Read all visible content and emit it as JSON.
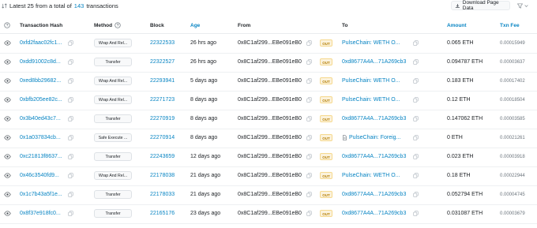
{
  "summary": {
    "prefix": "Latest 25 from a total of",
    "count": "143",
    "suffix": "transactions"
  },
  "toolbar": {
    "download_label": "Download Page Data"
  },
  "columns": {
    "hash": "Transaction Hash",
    "method": "Method",
    "block": "Block",
    "age": "Age",
    "from": "From",
    "to": "To",
    "amount": "Amount",
    "fee": "Txn Fee"
  },
  "rows": [
    {
      "hash": "0xfd2faac02fc1...",
      "method": "Wrap And Rel...",
      "block": "22322533",
      "age": "26 hrs ago",
      "from": "0x8C1af299...EBe091eB0",
      "direction": "OUT",
      "to": "PulseChain: WETH O...",
      "to_icon": "none",
      "amount": "0.065 ETH",
      "fee": "0.00015949"
    },
    {
      "hash": "0xdd91002c8d...",
      "method": "Transfer",
      "block": "22322527",
      "age": "26 hrs ago",
      "from": "0x8C1af299...EBe091eB0",
      "direction": "OUT",
      "to": "0xd8677A4A...71A269cb3",
      "to_icon": "none",
      "amount": "0.094787 ETH",
      "fee": "0.00003637"
    },
    {
      "hash": "0xed8bb29682...",
      "method": "Wrap And Rel...",
      "block": "22293941",
      "age": "5 days ago",
      "from": "0x8C1af299...EBe091eB0",
      "direction": "OUT",
      "to": "PulseChain: WETH O...",
      "to_icon": "none",
      "amount": "0.183 ETH",
      "fee": "0.00017402"
    },
    {
      "hash": "0xbfb205ee82c...",
      "method": "Wrap And Rel...",
      "block": "22271723",
      "age": "8 days ago",
      "from": "0x8C1af299...EBe091eB0",
      "direction": "OUT",
      "to": "PulseChain: WETH O...",
      "to_icon": "none",
      "amount": "0.12 ETH",
      "fee": "0.00018504"
    },
    {
      "hash": "0x3b40ed43c7...",
      "method": "Transfer",
      "block": "22270919",
      "age": "8 days ago",
      "from": "0x8C1af299...EBe091eB0",
      "direction": "OUT",
      "to": "0xd8677A4A...71A269cb3",
      "to_icon": "none",
      "amount": "0.147062 ETH",
      "fee": "0.00003585"
    },
    {
      "hash": "0x1a037834cb...",
      "method": "Safe Execute ...",
      "block": "22270914",
      "age": "8 days ago",
      "from": "0x8C1af299...EBe091eB0",
      "direction": "OUT",
      "to": "PulseChain: Foreig...",
      "to_icon": "document",
      "amount": "0 ETH",
      "fee": "0.00021261"
    },
    {
      "hash": "0xc21813f8637...",
      "method": "Transfer",
      "block": "22243659",
      "age": "12 days ago",
      "from": "0x8C1af299...EBe091eB0",
      "direction": "OUT",
      "to": "0xd8677A4A...71A269cb3",
      "to_icon": "none",
      "amount": "0.023 ETH",
      "fee": "0.00003918"
    },
    {
      "hash": "0x46c3540fd9...",
      "method": "Wrap And Rel...",
      "block": "22178038",
      "age": "21 days ago",
      "from": "0x8C1af299...EBe091eB0",
      "direction": "OUT",
      "to": "PulseChain: WETH O...",
      "to_icon": "none",
      "amount": "0.18 ETH",
      "fee": "0.00022944"
    },
    {
      "hash": "0x1c7b43a5f1e...",
      "method": "Transfer",
      "block": "22178033",
      "age": "21 days ago",
      "from": "0x8C1af299...EBe091eB0",
      "direction": "OUT",
      "to": "0xd8677A4A...71A269cb3",
      "to_icon": "none",
      "amount": "0.052794 ETH",
      "fee": "0.00004745"
    },
    {
      "hash": "0x8f37e918fc0...",
      "method": "Transfer",
      "block": "22165176",
      "age": "23 days ago",
      "from": "0x8C1af299...EBe091eB0",
      "direction": "OUT",
      "to": "0xd8677A4A...71A269cb3",
      "to_icon": "none",
      "amount": "0.031087 ETH",
      "fee": "0.00003679"
    }
  ]
}
